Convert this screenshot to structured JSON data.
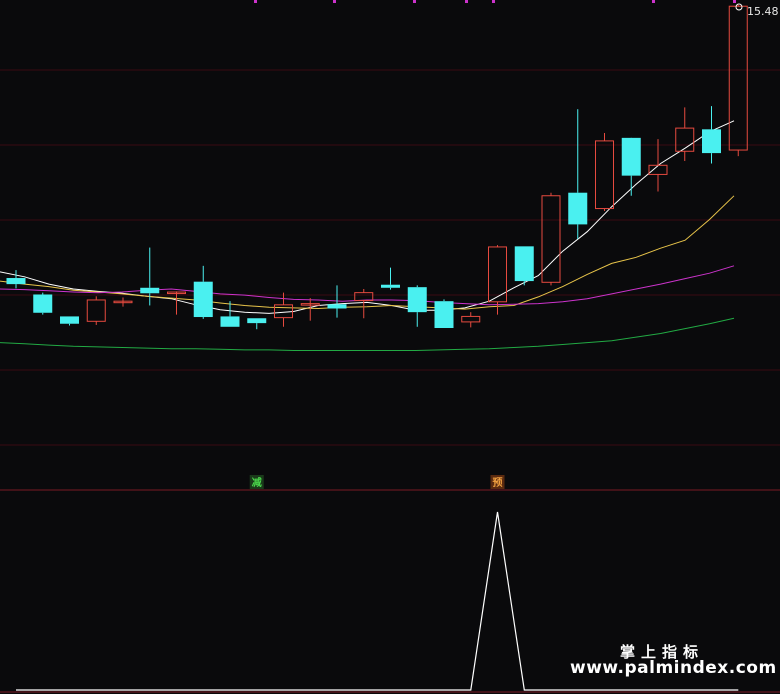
{
  "chart_data": {
    "type": "candlestick",
    "last_price_label": "15.48",
    "candles": [
      {
        "o": 11.0,
        "h": 11.13,
        "l": 10.83,
        "c": 10.9
      },
      {
        "o": 10.73,
        "h": 10.76,
        "l": 10.4,
        "c": 10.43
      },
      {
        "o": 10.37,
        "h": 10.37,
        "l": 10.22,
        "c": 10.25
      },
      {
        "o": 10.29,
        "h": 10.7,
        "l": 10.23,
        "c": 10.64
      },
      {
        "o": 10.62,
        "h": 10.68,
        "l": 10.53,
        "c": 10.62
      },
      {
        "o": 10.84,
        "h": 11.5,
        "l": 10.55,
        "c": 10.75
      },
      {
        "o": 10.77,
        "h": 10.78,
        "l": 10.4,
        "c": 10.77
      },
      {
        "o": 10.94,
        "h": 11.2,
        "l": 10.33,
        "c": 10.36
      },
      {
        "o": 10.37,
        "h": 10.62,
        "l": 10.2,
        "c": 10.2
      },
      {
        "o": 10.34,
        "h": 10.34,
        "l": 10.16,
        "c": 10.26
      },
      {
        "o": 10.35,
        "h": 10.76,
        "l": 10.2,
        "c": 10.56
      },
      {
        "o": 10.58,
        "h": 10.67,
        "l": 10.3,
        "c": 10.58
      },
      {
        "o": 10.57,
        "h": 10.88,
        "l": 10.35,
        "c": 10.5
      },
      {
        "o": 10.63,
        "h": 10.82,
        "l": 10.34,
        "c": 10.76
      },
      {
        "o": 10.89,
        "h": 11.17,
        "l": 10.81,
        "c": 10.84
      },
      {
        "o": 10.85,
        "h": 10.88,
        "l": 10.2,
        "c": 10.44
      },
      {
        "o": 10.62,
        "h": 10.65,
        "l": 10.19,
        "c": 10.18
      },
      {
        "o": 10.28,
        "h": 10.44,
        "l": 10.19,
        "c": 10.37
      },
      {
        "o": 10.61,
        "h": 11.54,
        "l": 10.4,
        "c": 11.51
      },
      {
        "o": 11.52,
        "h": 11.52,
        "l": 10.88,
        "c": 10.95
      },
      {
        "o": 10.93,
        "h": 12.4,
        "l": 10.88,
        "c": 12.35
      },
      {
        "o": 12.4,
        "h": 13.77,
        "l": 11.64,
        "c": 11.88
      },
      {
        "o": 12.14,
        "h": 13.38,
        "l": 12.1,
        "c": 13.25
      },
      {
        "o": 13.3,
        "h": 13.12,
        "l": 12.35,
        "c": 12.68
      },
      {
        "o": 12.7,
        "h": 13.28,
        "l": 12.42,
        "c": 12.85
      },
      {
        "o": 13.08,
        "h": 13.8,
        "l": 12.92,
        "c": 13.46
      },
      {
        "o": 13.44,
        "h": 13.82,
        "l": 12.88,
        "c": 13.05
      },
      {
        "o": 13.1,
        "h": 15.48,
        "l": 13.0,
        "c": 15.46
      }
    ],
    "moving_averages": [
      {
        "color": "#ffffff",
        "values": [
          11.1,
          11.02,
          10.9,
          10.82,
          10.78,
          10.75,
          10.7,
          10.66,
          10.56,
          10.48,
          10.44,
          10.42,
          10.45,
          10.55,
          10.58,
          10.6,
          10.55,
          10.47,
          10.47,
          10.51,
          10.62,
          10.84,
          11.04,
          11.44,
          11.76,
          12.17,
          12.54,
          12.88,
          13.13,
          13.4,
          13.58
        ]
      },
      {
        "color": "#e8c44a",
        "values": [
          10.95,
          10.9,
          10.86,
          10.8,
          10.77,
          10.74,
          10.7,
          10.67,
          10.64,
          10.59,
          10.55,
          10.52,
          10.51,
          10.5,
          10.52,
          10.53,
          10.55,
          10.53,
          10.51,
          10.49,
          10.53,
          10.55,
          10.69,
          10.86,
          11.06,
          11.24,
          11.34,
          11.49,
          11.62,
          11.96,
          12.35
        ]
      },
      {
        "color": "#cc33cc",
        "values": [
          10.82,
          10.81,
          10.79,
          10.77,
          10.76,
          10.77,
          10.8,
          10.82,
          10.78,
          10.74,
          10.72,
          10.68,
          10.65,
          10.64,
          10.62,
          10.64,
          10.64,
          10.63,
          10.6,
          10.58,
          10.56,
          10.57,
          10.58,
          10.61,
          10.66,
          10.74,
          10.82,
          10.9,
          10.99,
          11.08,
          11.2
        ]
      },
      {
        "color": "#22aa44",
        "values": [
          9.94,
          9.92,
          9.9,
          9.88,
          9.87,
          9.86,
          9.85,
          9.84,
          9.84,
          9.83,
          9.82,
          9.82,
          9.81,
          9.81,
          9.81,
          9.81,
          9.81,
          9.81,
          9.82,
          9.83,
          9.84,
          9.86,
          9.88,
          9.91,
          9.94,
          9.97,
          10.03,
          10.09,
          10.17,
          10.25,
          10.34
        ]
      }
    ],
    "signal": [
      0,
      0,
      0,
      0,
      0,
      0,
      0,
      0,
      0,
      0,
      0,
      0,
      0,
      0,
      0,
      0,
      0,
      0,
      1,
      0,
      0,
      0,
      0,
      0,
      0,
      0,
      0,
      0
    ],
    "markers": [
      {
        "index": 9,
        "label": "减",
        "color": "#4bd84b",
        "bg": "#1a3a1a"
      },
      {
        "index": 18,
        "label": "预",
        "color": "#f0a040",
        "bg": "#5a2a10"
      }
    ],
    "colors": {
      "up": "#e64a3f",
      "down": "#4af0f0",
      "background": "#0a0a0c",
      "grid": "#3a0a12",
      "separator": "#7a1a24",
      "signal": "#ffffff",
      "tick": "#cc33cc"
    }
  },
  "watermark": {
    "line1": "掌上指标",
    "line2": "www.palmindex.com"
  }
}
